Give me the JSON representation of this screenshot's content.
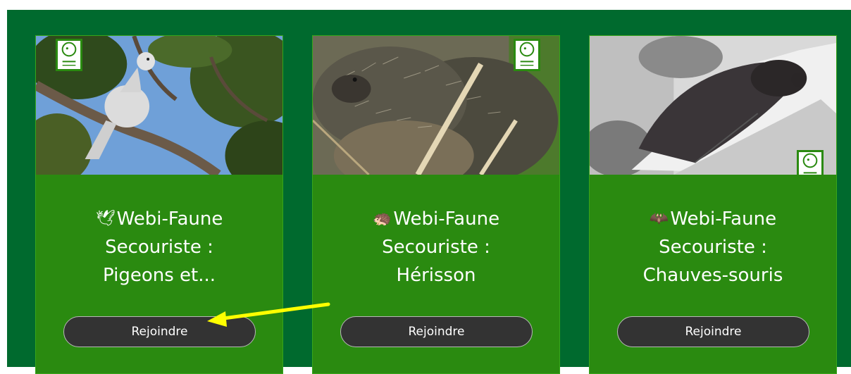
{
  "cards": [
    {
      "icon": "dove-icon",
      "emoji": "🕊",
      "title_line1": "Webi-Faune",
      "title_line2": "Secouriste :",
      "title_line3": "Pigeons et...",
      "button_label": "Rejoindre"
    },
    {
      "icon": "hedgehog-icon",
      "emoji": "🦔",
      "title_line1": "Webi-Faune",
      "title_line2": "Secouriste :",
      "title_line3": "Hérisson",
      "button_label": "Rejoindre"
    },
    {
      "icon": "bat-icon",
      "emoji": "🦇",
      "title_line1": "Webi-Faune",
      "title_line2": "Secouriste :",
      "title_line3": "Chauves-souris",
      "button_label": "Rejoindre"
    }
  ],
  "colors": {
    "panel_background": "#006a2e",
    "card_background": "#2a8a10",
    "button_background": "#333333",
    "annotation_arrow": "#ffff00"
  }
}
